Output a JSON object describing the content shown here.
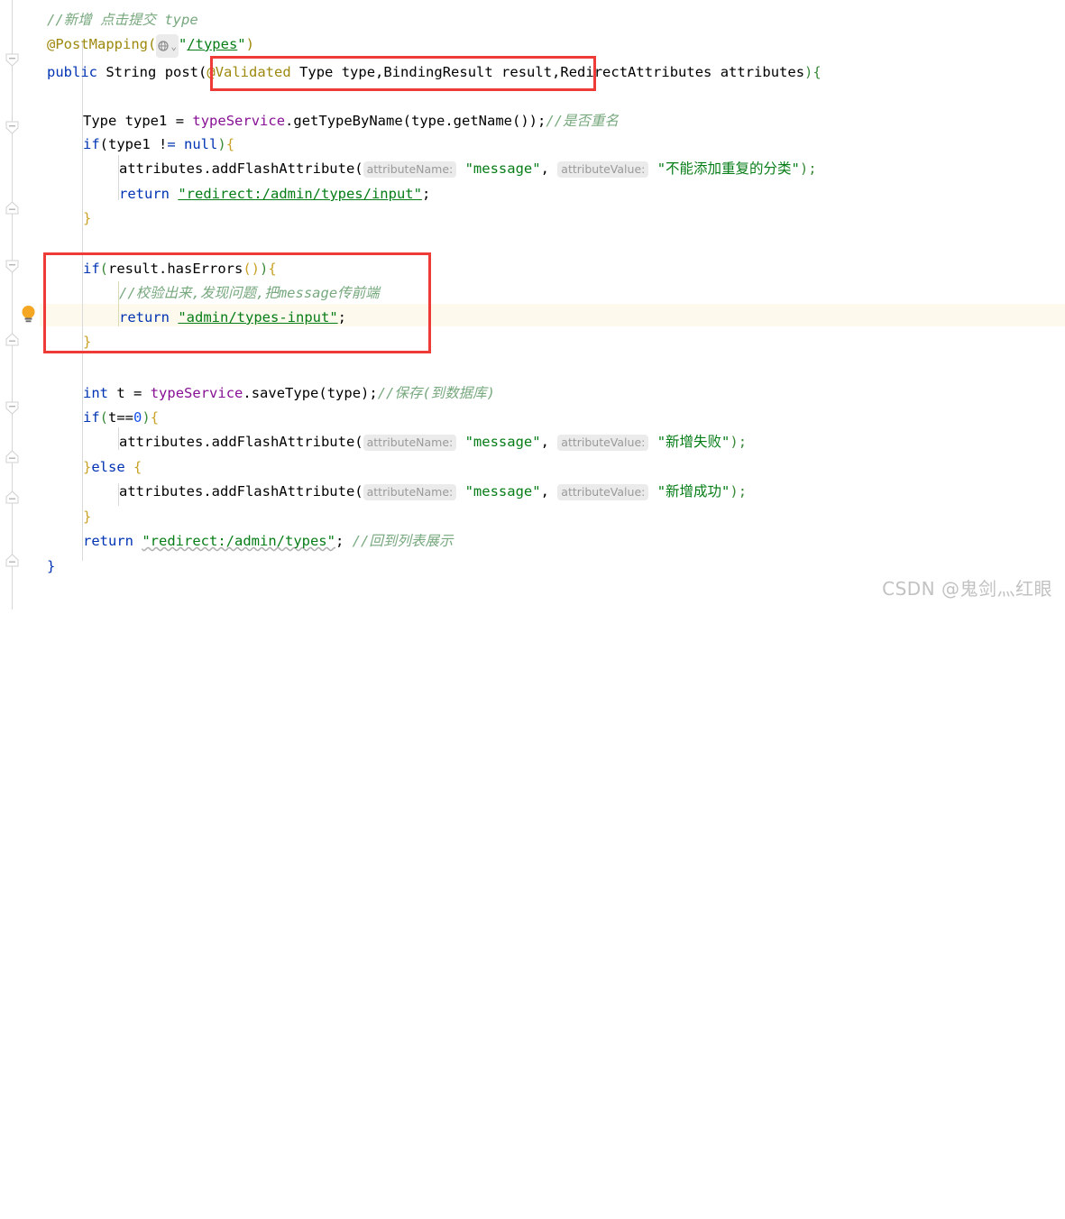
{
  "editor": {
    "language": "java",
    "theme": "IntelliJ Light",
    "current_line_number": 80
  },
  "colors": {
    "background": "#ffffff",
    "keyword": "#0033b3",
    "string": "#067d17",
    "comment": "#8c8c8c",
    "comment_chinese": "#77a87e",
    "annotation": "#9e880d",
    "field": "#871094",
    "number": "#1750eb",
    "inlay_hint_bg": "#ebebeb",
    "inlay_hint_fg": "#9a9a9a",
    "highlight_row": "#fdf9ec",
    "annotation_box": "#ef3b38",
    "watermark": "#c2c2c2",
    "gutter_rail": "#d6d6d6",
    "indent_guide": "#d9d9d9",
    "indent_guide_active": "#dcdcb4"
  },
  "code": {
    "line_01_comment": "//新增 点击提交 type",
    "line_02": {
      "annotation": "@PostMapping",
      "open_paren": "(",
      "icon": "globe-mapping-icon",
      "chevron": "⌄",
      "quote": "\"",
      "url": "/types",
      "quote_close": "\"",
      "close_paren": ")"
    },
    "line_03": {
      "modifier": "public",
      "return_type": "String",
      "method_name": "post",
      "open_paren": "(",
      "validated_annotation": "@Validated",
      "param1_type": "Type",
      "param1_name": "type",
      "comma1": ",",
      "param2_type": "BindingResult",
      "param2_name": "result",
      "comma2": ",",
      "param3_type": "RedirectAttributes",
      "param3_name": "attributes",
      "close_paren": ")",
      "open_brace": "{"
    },
    "line_05": {
      "type": "Type",
      "var": "type1",
      "eq": "=",
      "service": "typeService",
      "call": ".getTypeByName(type.getName());",
      "comment": "//是否重名"
    },
    "line_06": "if(type1 != null){",
    "line_07": {
      "call": "attributes.addFlashAttribute(",
      "hint1": "attributeName:",
      "arg1": "\"message\"",
      "comma": ",",
      "hint2": "attributeValue:",
      "arg2": "\"不能添加重复的分类\"",
      "tail": ");"
    },
    "line_08": {
      "keyword": "return",
      "string": "\"redirect:/admin/types/input\"",
      "semicolon": ";"
    },
    "line_09": "}",
    "line_11": "if(result.hasErrors()){",
    "line_12_comment": "//校验出来,发现问题,把message传前端",
    "line_13": {
      "keyword": "return",
      "string": "\"admin/types-input\"",
      "semicolon": ";"
    },
    "line_14": "}",
    "line_16": {
      "type": "int",
      "var": "t",
      "eq": "=",
      "service": "typeService",
      "call": ".saveType(type);",
      "comment": "//保存(到数据库)"
    },
    "line_17": "if(t==0){",
    "line_18": {
      "call": "attributes.addFlashAttribute(",
      "hint1": "attributeName:",
      "arg1": "\"message\"",
      "comma": ",",
      "hint2": "attributeValue:",
      "arg2": "\"新增失败\"",
      "tail": ");"
    },
    "line_19": "}else {",
    "line_20": {
      "call": "attributes.addFlashAttribute(",
      "hint1": "attributeName:",
      "arg1": "\"message\"",
      "comma": ",",
      "hint2": "attributeValue:",
      "arg2": "\"新增成功\"",
      "tail": ");"
    },
    "line_21": "}",
    "line_22": {
      "keyword": "return",
      "string": "\"redirect:/admin/types\"",
      "semicolon": ";",
      "comment": "//回到列表展示"
    },
    "line_23": "}"
  },
  "annotations": {
    "box1_label": "validated-params-highlight",
    "box2_label": "has-errors-block-highlight"
  },
  "watermark": {
    "text": "CSDN @鬼剑灬红眼"
  }
}
